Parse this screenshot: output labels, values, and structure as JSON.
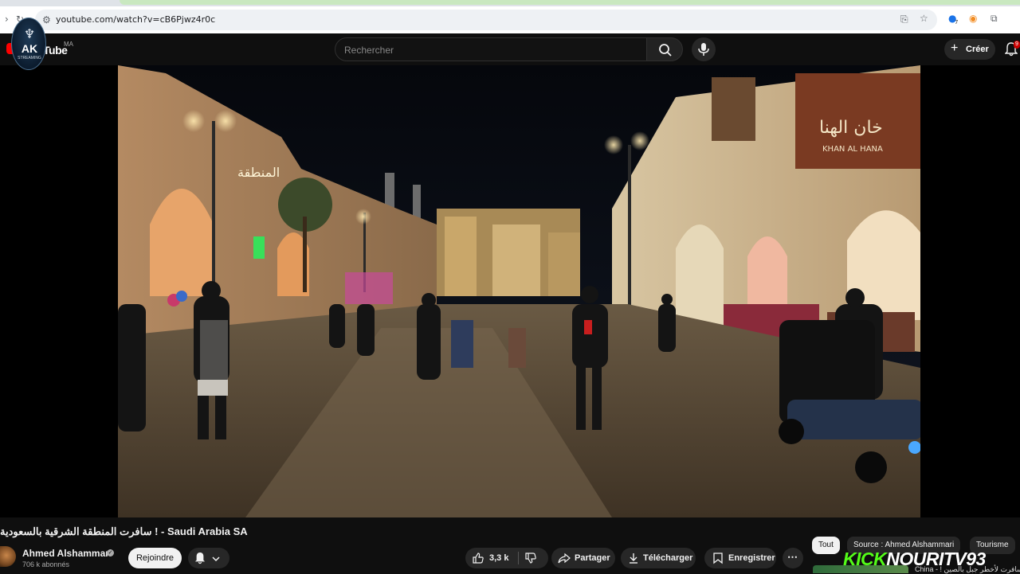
{
  "browser": {
    "url": "youtube.com/watch?v=cB6Pjwz4r0c",
    "extension_badge": "7"
  },
  "header": {
    "logo_text": "Tube",
    "country_code": "MA",
    "search_placeholder": "Rechercher",
    "create_label": "Créer",
    "notification_count": "9"
  },
  "overlay_badge": {
    "text": "AK",
    "subtext": "STREAMING"
  },
  "video": {
    "title": "سافرت المنطقة الشرقية بالسعودية ! - Saudi Arabia SA",
    "shop_sign": "KHAN AL HANA"
  },
  "channel": {
    "name": "Ahmed Alshammari",
    "subscribers": "706 k abonnés",
    "join_label": "Rejoindre"
  },
  "actions": {
    "likes": "3,3 k",
    "share": "Partager",
    "download": "Télécharger",
    "save": "Enregistrer"
  },
  "chips": [
    "Tout",
    "Source : Ahmed Alshammari",
    "Tourisme"
  ],
  "recommendation": {
    "title": "China - ! سافرت لأخطر جبل بالصين"
  },
  "watermark": {
    "kick": "KICK",
    "handle": "NOURITV93"
  },
  "colors": {
    "page_bg": "#0f0f0f",
    "youtube_red": "#ff0000",
    "kick_green": "#53fc18"
  }
}
